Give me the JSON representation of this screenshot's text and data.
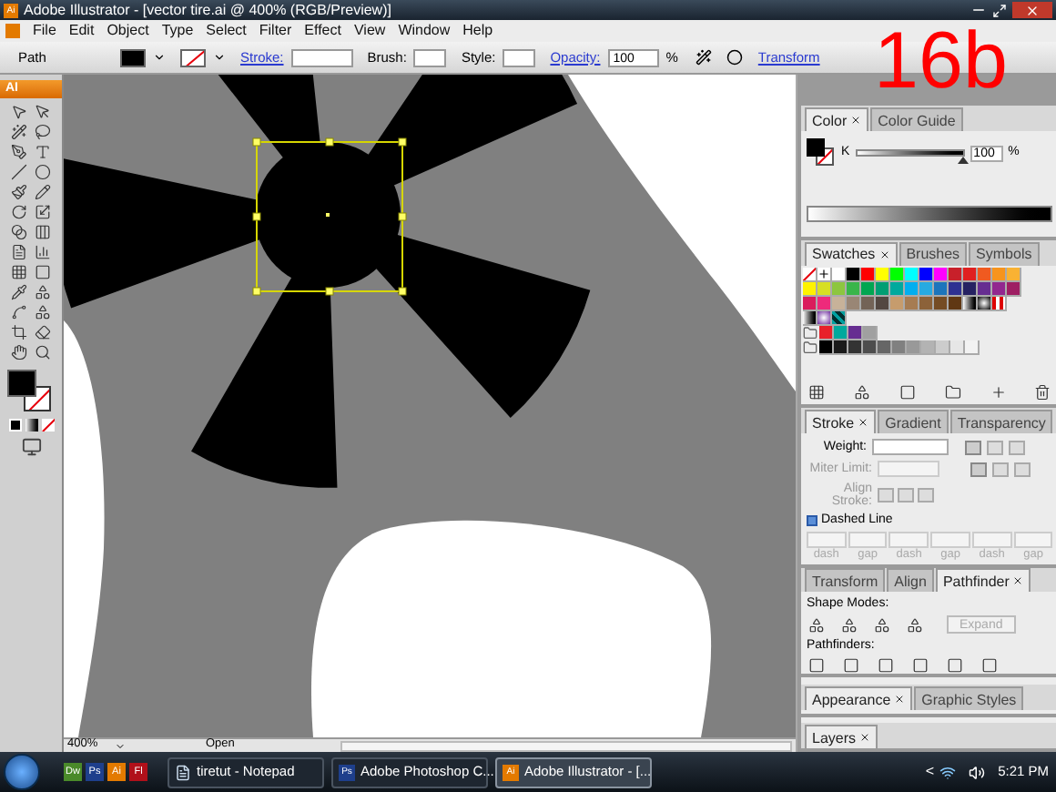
{
  "window": {
    "title": "Adobe Illustrator - [vector tire.ai @ 400% (RGB/Preview)]",
    "app_icon": "Ai"
  },
  "menu": [
    "File",
    "Edit",
    "Object",
    "Type",
    "Select",
    "Filter",
    "Effect",
    "View",
    "Window",
    "Help"
  ],
  "control_bar": {
    "selection": "Path",
    "stroke_label": "Stroke:",
    "brush_label": "Brush:",
    "style_label": "Style:",
    "opacity_label": "Opacity:",
    "opacity": "100",
    "opacity_unit": "%",
    "transform_link": "Transform"
  },
  "tools": {
    "logo": "AI"
  },
  "overlay_label": "16b",
  "color_panel": {
    "tabs": [
      {
        "label": "Color",
        "selected": true
      },
      {
        "label": "Color Guide",
        "selected": false
      }
    ],
    "channel": "K",
    "level": 1,
    "value": "100",
    "unit": "%"
  },
  "swatches_panel": {
    "tabs": [
      {
        "label": "Swatches",
        "selected": true
      },
      {
        "label": "Brushes",
        "selected": false
      },
      {
        "label": "Symbols",
        "selected": false
      }
    ],
    "rows": [
      [
        {
          "kind": "none"
        },
        {
          "kind": "registration"
        },
        {
          "kind": "color",
          "color": "#ffffff"
        },
        {
          "kind": "color",
          "color": "#000000"
        },
        {
          "kind": "color",
          "color": "#ff0000"
        },
        {
          "kind": "color",
          "color": "#ffff00"
        },
        {
          "kind": "color",
          "color": "#00ff00"
        },
        {
          "kind": "color",
          "color": "#00ffff"
        },
        {
          "kind": "color",
          "color": "#0000ff"
        },
        {
          "kind": "color",
          "color": "#ff00ff"
        },
        {
          "kind": "color",
          "color": "#c8202a"
        },
        {
          "kind": "color",
          "color": "#e02020"
        },
        {
          "kind": "color",
          "color": "#f05a20"
        },
        {
          "kind": "color",
          "color": "#f7941d"
        },
        {
          "kind": "color",
          "color": "#f9b233"
        }
      ],
      [
        {
          "kind": "color",
          "color": "#fff200"
        },
        {
          "kind": "color",
          "color": "#d7df23"
        },
        {
          "kind": "color",
          "color": "#8dc63f"
        },
        {
          "kind": "color",
          "color": "#39b54a"
        },
        {
          "kind": "color",
          "color": "#00a651"
        },
        {
          "kind": "color",
          "color": "#009e73"
        },
        {
          "kind": "color",
          "color": "#00a99d"
        },
        {
          "kind": "color",
          "color": "#00aeef"
        },
        {
          "kind": "color",
          "color": "#27aae1"
        },
        {
          "kind": "color",
          "color": "#1c75bc"
        },
        {
          "kind": "color",
          "color": "#2e3192"
        },
        {
          "kind": "color",
          "color": "#262262"
        },
        {
          "kind": "color",
          "color": "#662d91"
        },
        {
          "kind": "color",
          "color": "#92278f"
        },
        {
          "kind": "color",
          "color": "#9e1f63"
        }
      ],
      [
        {
          "kind": "color",
          "color": "#da1c5c"
        },
        {
          "kind": "color",
          "color": "#ee2a7b"
        },
        {
          "kind": "color",
          "color": "#c7b299"
        },
        {
          "kind": "color",
          "color": "#998675"
        },
        {
          "kind": "color",
          "color": "#736357"
        },
        {
          "kind": "color",
          "color": "#534741"
        },
        {
          "kind": "color",
          "color": "#c69c6d"
        },
        {
          "kind": "color",
          "color": "#a67c52"
        },
        {
          "kind": "color",
          "color": "#8c6239"
        },
        {
          "kind": "color",
          "color": "#754c24"
        },
        {
          "kind": "color",
          "color": "#603813"
        },
        {
          "kind": "gradient"
        },
        {
          "kind": "radial"
        },
        {
          "kind": "stripe"
        }
      ],
      [
        {
          "kind": "gradient"
        },
        {
          "kind": "violet"
        },
        {
          "kind": "teal"
        }
      ],
      [
        {
          "kind": "folder"
        },
        {
          "kind": "color",
          "color": "#e8212a"
        },
        {
          "kind": "color",
          "color": "#00a99d"
        },
        {
          "kind": "color",
          "color": "#662d91"
        },
        {
          "kind": "color",
          "color": "#a0a0a0"
        }
      ],
      [
        {
          "kind": "folder"
        },
        {
          "kind": "color",
          "color": "#000000"
        },
        {
          "kind": "color",
          "color": "#1a1a1a"
        },
        {
          "kind": "color",
          "color": "#333333"
        },
        {
          "kind": "color",
          "color": "#4d4d4d"
        },
        {
          "kind": "color",
          "color": "#666666"
        },
        {
          "kind": "color",
          "color": "#808080"
        },
        {
          "kind": "color",
          "color": "#999999"
        },
        {
          "kind": "color",
          "color": "#b3b3b3"
        },
        {
          "kind": "color",
          "color": "#cccccc"
        },
        {
          "kind": "color",
          "color": "#e6e6e6"
        },
        {
          "kind": "color",
          "color": "#f2f2f2"
        }
      ]
    ]
  },
  "stroke_panel": {
    "tabs": [
      {
        "label": "Stroke",
        "selected": true
      },
      {
        "label": "Gradient",
        "selected": false
      },
      {
        "label": "Transparency",
        "selected": false
      }
    ],
    "weight_label": "Weight:",
    "miter_label": "Miter Limit:",
    "align_label": "Align Stroke:",
    "dashed_label": "Dashed Line",
    "dashed": false,
    "dash_labels": [
      "dash",
      "gap",
      "dash",
      "gap",
      "dash",
      "gap"
    ]
  },
  "pathfinder_panel": {
    "tabs": [
      {
        "label": "Transform",
        "selected": false
      },
      {
        "label": "Align",
        "selected": false
      },
      {
        "label": "Pathfinder",
        "selected": true
      }
    ],
    "shape_modes_label": "Shape Modes:",
    "expand_button": "Expand",
    "pathfinders_label": "Pathfinders:"
  },
  "appearance_panel": {
    "tabs": [
      {
        "label": "Appearance",
        "selected": true
      },
      {
        "label": "Graphic Styles",
        "selected": false
      }
    ]
  },
  "layers_panel": {
    "tabs": [
      {
        "label": "Layers",
        "selected": true
      }
    ]
  },
  "status_bar": {
    "zoom": "400%",
    "status": "Open"
  },
  "taskbar": {
    "quick_launch": [
      {
        "label": "Dw",
        "color": "#4a8a2a"
      },
      {
        "label": "Ps",
        "color": "#1e3f8c"
      },
      {
        "label": "Ai",
        "color": "#e37a00"
      },
      {
        "label": "Fl",
        "color": "#b0101a"
      }
    ],
    "tasks": [
      {
        "label": "tiretut - Notepad",
        "kind": "notepad",
        "selected": false
      },
      {
        "label": "Adobe Photoshop C...",
        "kind": "app",
        "icon_text": "Ps",
        "color": "#1e3f8c",
        "selected": false
      },
      {
        "label": "Adobe Illustrator - [...",
        "kind": "app",
        "icon_text": "Ai",
        "color": "#e37a00",
        "selected": true
      }
    ],
    "tray_toggle": "<",
    "clock": "5:21 PM"
  }
}
